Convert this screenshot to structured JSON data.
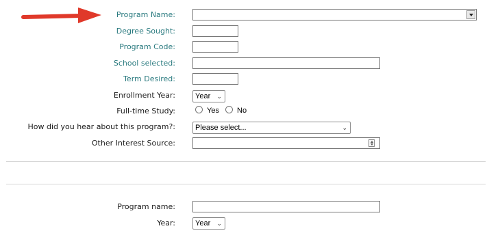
{
  "colors": {
    "label_teal": "#2a7a7f",
    "arrow_red": "#e0392a"
  },
  "form": {
    "program_name_label": "Program Name:",
    "degree_sought_label": "Degree Sought:",
    "program_code_label": "Program Code:",
    "school_selected_label": "School selected:",
    "term_desired_label": "Term Desired:",
    "enrollment_year_label": "Enrollment Year:",
    "enrollment_year_value": "Year",
    "full_time_label": "Full-time Study:",
    "full_time_options": [
      "Yes",
      "No"
    ],
    "hear_about_label": "How did you hear about this program?:",
    "hear_about_value": "Please select...",
    "other_interest_label": "Other Interest Source:"
  },
  "second_section": {
    "program_name_label": "Program name:",
    "year_label": "Year:",
    "year_value": "Year"
  }
}
